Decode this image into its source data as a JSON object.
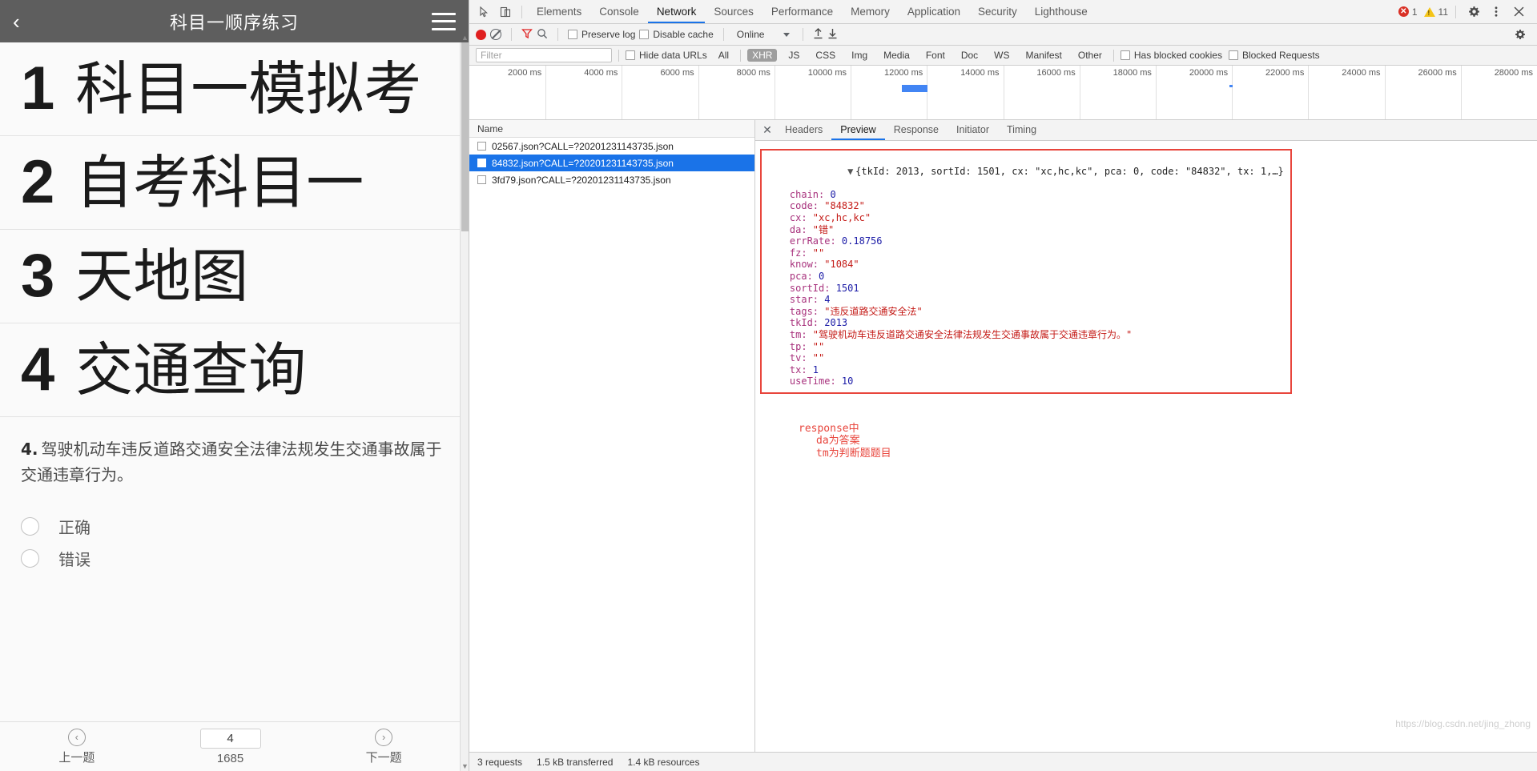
{
  "mobile": {
    "header": {
      "title": "科目一顺序练习",
      "back_icon": "chevron-left-icon",
      "menu_icon": "hamburger-icon"
    },
    "menu_items": [
      {
        "num": "1",
        "label": "科目一模拟考"
      },
      {
        "num": "2",
        "label": "自考科目一"
      },
      {
        "num": "3",
        "label": "天地图"
      },
      {
        "num": "4",
        "label": "交通查询"
      }
    ],
    "question": {
      "number": "4.",
      "text": "驾驶机动车违反道路交通安全法律法规发生交通事故属于交通违章行为。",
      "options": [
        {
          "label": "正确",
          "selected": false
        },
        {
          "label": "错误",
          "selected": false
        }
      ]
    },
    "footer": {
      "prev_label": "上一题",
      "prev_icon": "chevron-left-circle-icon",
      "next_label": "下一题",
      "next_icon": "chevron-right-circle-icon",
      "current_page": "4",
      "total_pages": "1685"
    }
  },
  "devtools": {
    "tabs": [
      {
        "label": "Elements",
        "active": false
      },
      {
        "label": "Console",
        "active": false
      },
      {
        "label": "Network",
        "active": true
      },
      {
        "label": "Sources",
        "active": false
      },
      {
        "label": "Performance",
        "active": false
      },
      {
        "label": "Memory",
        "active": false
      },
      {
        "label": "Application",
        "active": false
      },
      {
        "label": "Security",
        "active": false
      },
      {
        "label": "Lighthouse",
        "active": false
      }
    ],
    "left_icons": [
      {
        "name": "inspect-element-icon"
      },
      {
        "name": "device-toolbar-icon"
      }
    ],
    "status_counts": {
      "errors": "1",
      "warnings": "11"
    },
    "right_icons": [
      {
        "name": "settings-gear-icon"
      },
      {
        "name": "more-options-icon"
      },
      {
        "name": "close-devtools-icon"
      }
    ],
    "toolbar": {
      "record_icon": "record-button-icon",
      "clear_icon": "clear-icon",
      "filter_icon": "filter-funnel-icon",
      "search_icon": "search-icon",
      "preserve_log_label": "Preserve log",
      "preserve_log_checked": false,
      "disable_cache_label": "Disable cache",
      "disable_cache_checked": false,
      "throttle_value": "Online",
      "import_icon": "upload-har-icon",
      "export_icon": "download-har-icon",
      "settings_icon": "network-settings-gear-icon"
    },
    "filterbar": {
      "filter_placeholder": "Filter",
      "filter_value": "",
      "hide_data_urls_label": "Hide data URLs",
      "hide_data_urls_checked": false,
      "types": [
        "All",
        "XHR",
        "JS",
        "CSS",
        "Img",
        "Media",
        "Font",
        "Doc",
        "WS",
        "Manifest",
        "Other"
      ],
      "active_type": "XHR",
      "has_blocked_cookies_label": "Has blocked cookies",
      "has_blocked_cookies_checked": false,
      "blocked_requests_label": "Blocked Requests",
      "blocked_requests_checked": false
    },
    "timeline": {
      "ticks": [
        "2000 ms",
        "4000 ms",
        "6000 ms",
        "8000 ms",
        "10000 ms",
        "12000 ms",
        "14000 ms",
        "16000 ms",
        "18000 ms",
        "20000 ms",
        "22000 ms",
        "24000 ms",
        "26000 ms",
        "28000 ms"
      ]
    },
    "requests": {
      "column_header": "Name",
      "rows": [
        {
          "name": "02567.json?CALL=?20201231143735.json",
          "selected": false
        },
        {
          "name": "84832.json?CALL=?20201231143735.json",
          "selected": true
        },
        {
          "name": "3fd79.json?CALL=?20201231143735.json",
          "selected": false
        }
      ]
    },
    "detail_tabs": [
      {
        "label": "Headers",
        "active": false
      },
      {
        "label": "Preview",
        "active": true
      },
      {
        "label": "Response",
        "active": false
      },
      {
        "label": "Initiator",
        "active": false
      },
      {
        "label": "Timing",
        "active": false
      }
    ],
    "preview": {
      "summary_line": "{tkId: 2013, sortId: 1501, cx: \"xc,hc,kc\", pca: 0, code: \"84832\", tx: 1,…}",
      "fields": [
        {
          "key": "chain",
          "value": "0",
          "type": "num"
        },
        {
          "key": "code",
          "value": "\"84832\"",
          "type": "str"
        },
        {
          "key": "cx",
          "value": "\"xc,hc,kc\"",
          "type": "str"
        },
        {
          "key": "da",
          "value": "\"错\"",
          "type": "str"
        },
        {
          "key": "errRate",
          "value": "0.18756",
          "type": "num"
        },
        {
          "key": "fz",
          "value": "\"\"",
          "type": "str"
        },
        {
          "key": "know",
          "value": "\"1084\"",
          "type": "str"
        },
        {
          "key": "pca",
          "value": "0",
          "type": "num"
        },
        {
          "key": "sortId",
          "value": "1501",
          "type": "num"
        },
        {
          "key": "star",
          "value": "4",
          "type": "num"
        },
        {
          "key": "tags",
          "value": "\"违反道路交通安全法\"",
          "type": "str"
        },
        {
          "key": "tkId",
          "value": "2013",
          "type": "num"
        },
        {
          "key": "tm",
          "value": "\"驾驶机动车违反道路交通安全法律法规发生交通事故属于交通违章行为。\"",
          "type": "str"
        },
        {
          "key": "tp",
          "value": "\"\"",
          "type": "str"
        },
        {
          "key": "tv",
          "value": "\"\"",
          "type": "str"
        },
        {
          "key": "tx",
          "value": "1",
          "type": "num"
        },
        {
          "key": "useTime",
          "value": "10",
          "type": "num"
        }
      ],
      "annotation": [
        "response中",
        "da为答案",
        "tm为判断题题目"
      ]
    },
    "status_bar": {
      "requests": "3 requests",
      "transferred": "1.5 kB transferred",
      "resources": "1.4 kB resources"
    },
    "watermark": "https://blog.csdn.net/jing_zhong"
  }
}
